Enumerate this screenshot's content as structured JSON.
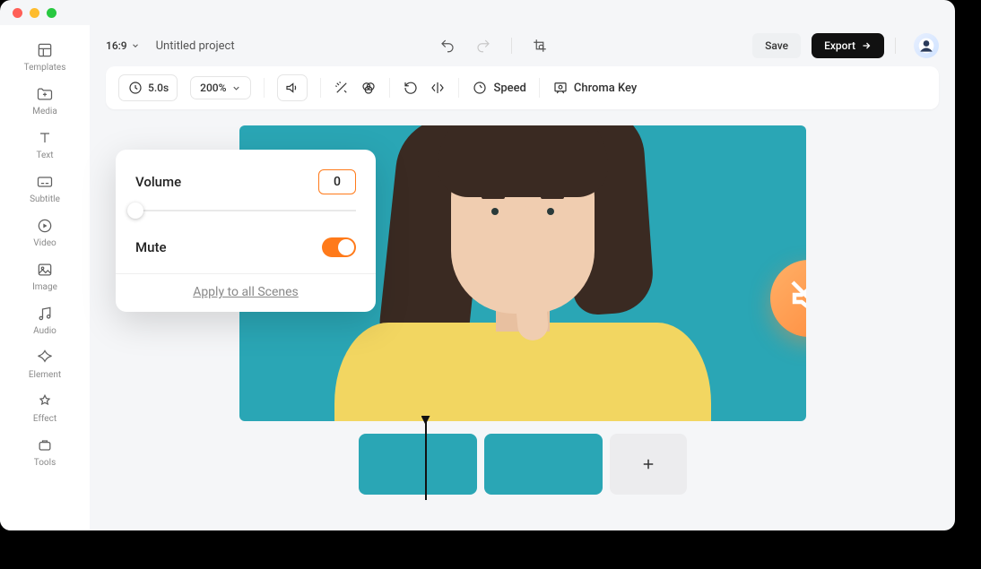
{
  "project": {
    "title": "Untitled project",
    "aspect_ratio": "16:9"
  },
  "topbar": {
    "save": "Save",
    "export": "Export"
  },
  "toolbar": {
    "duration": "5.0s",
    "zoom": "200%",
    "speed_label": "Speed",
    "chroma_label": "Chroma Key"
  },
  "sidebar": {
    "items": [
      {
        "label": "Templates"
      },
      {
        "label": "Media"
      },
      {
        "label": "Text"
      },
      {
        "label": "Subtitle"
      },
      {
        "label": "Video"
      },
      {
        "label": "Image"
      },
      {
        "label": "Audio"
      },
      {
        "label": "Element"
      },
      {
        "label": "Effect"
      },
      {
        "label": "Tools"
      }
    ]
  },
  "volume_panel": {
    "volume_label": "Volume",
    "volume_value": "0",
    "mute_label": "Mute",
    "mute_on": true,
    "apply_label": "Apply to all Scenes"
  },
  "timeline": {
    "scene_count": 2
  }
}
